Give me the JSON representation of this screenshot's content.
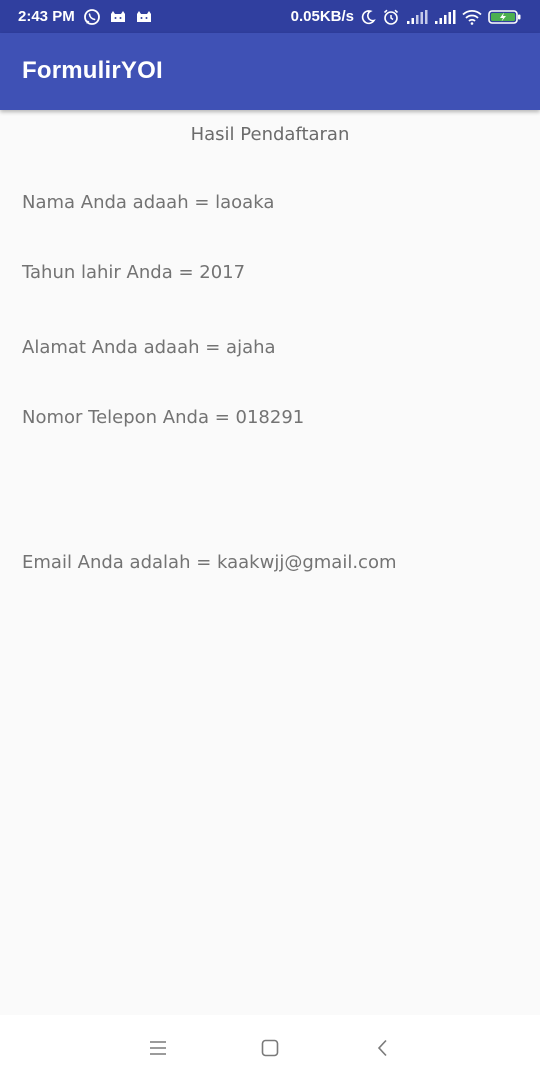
{
  "status_bar": {
    "time": "2:43 PM",
    "net_speed": "0.05KB/s",
    "left_icons": [
      "whatsapp-icon",
      "notification-cat-icon",
      "notification-cat-icon"
    ],
    "right_icons": [
      "moon-icon",
      "alarm-icon",
      "signal-icon",
      "signal-icon",
      "wifi-icon",
      "battery-charging-icon"
    ]
  },
  "app_bar": {
    "title": "FormulirYOI"
  },
  "main": {
    "heading": "Hasil Pendaftaran",
    "fields": [
      {
        "text": "Nama Anda adaah = laoaka"
      },
      {
        "text": "Tahun lahir Anda = 2017"
      },
      {
        "text": "Alamat Anda adaah = ajaha"
      },
      {
        "text": "Nomor Telepon Anda = 018291"
      },
      {
        "text": "Email Anda adalah = kaakwjj@gmail.com"
      }
    ]
  },
  "nav_bar": {
    "buttons": [
      "menu-icon",
      "home-icon",
      "back-icon"
    ]
  },
  "colors": {
    "status_bar": "#303f9f",
    "app_bar": "#3f51b5",
    "background": "#fafafa",
    "text": "#737373"
  }
}
